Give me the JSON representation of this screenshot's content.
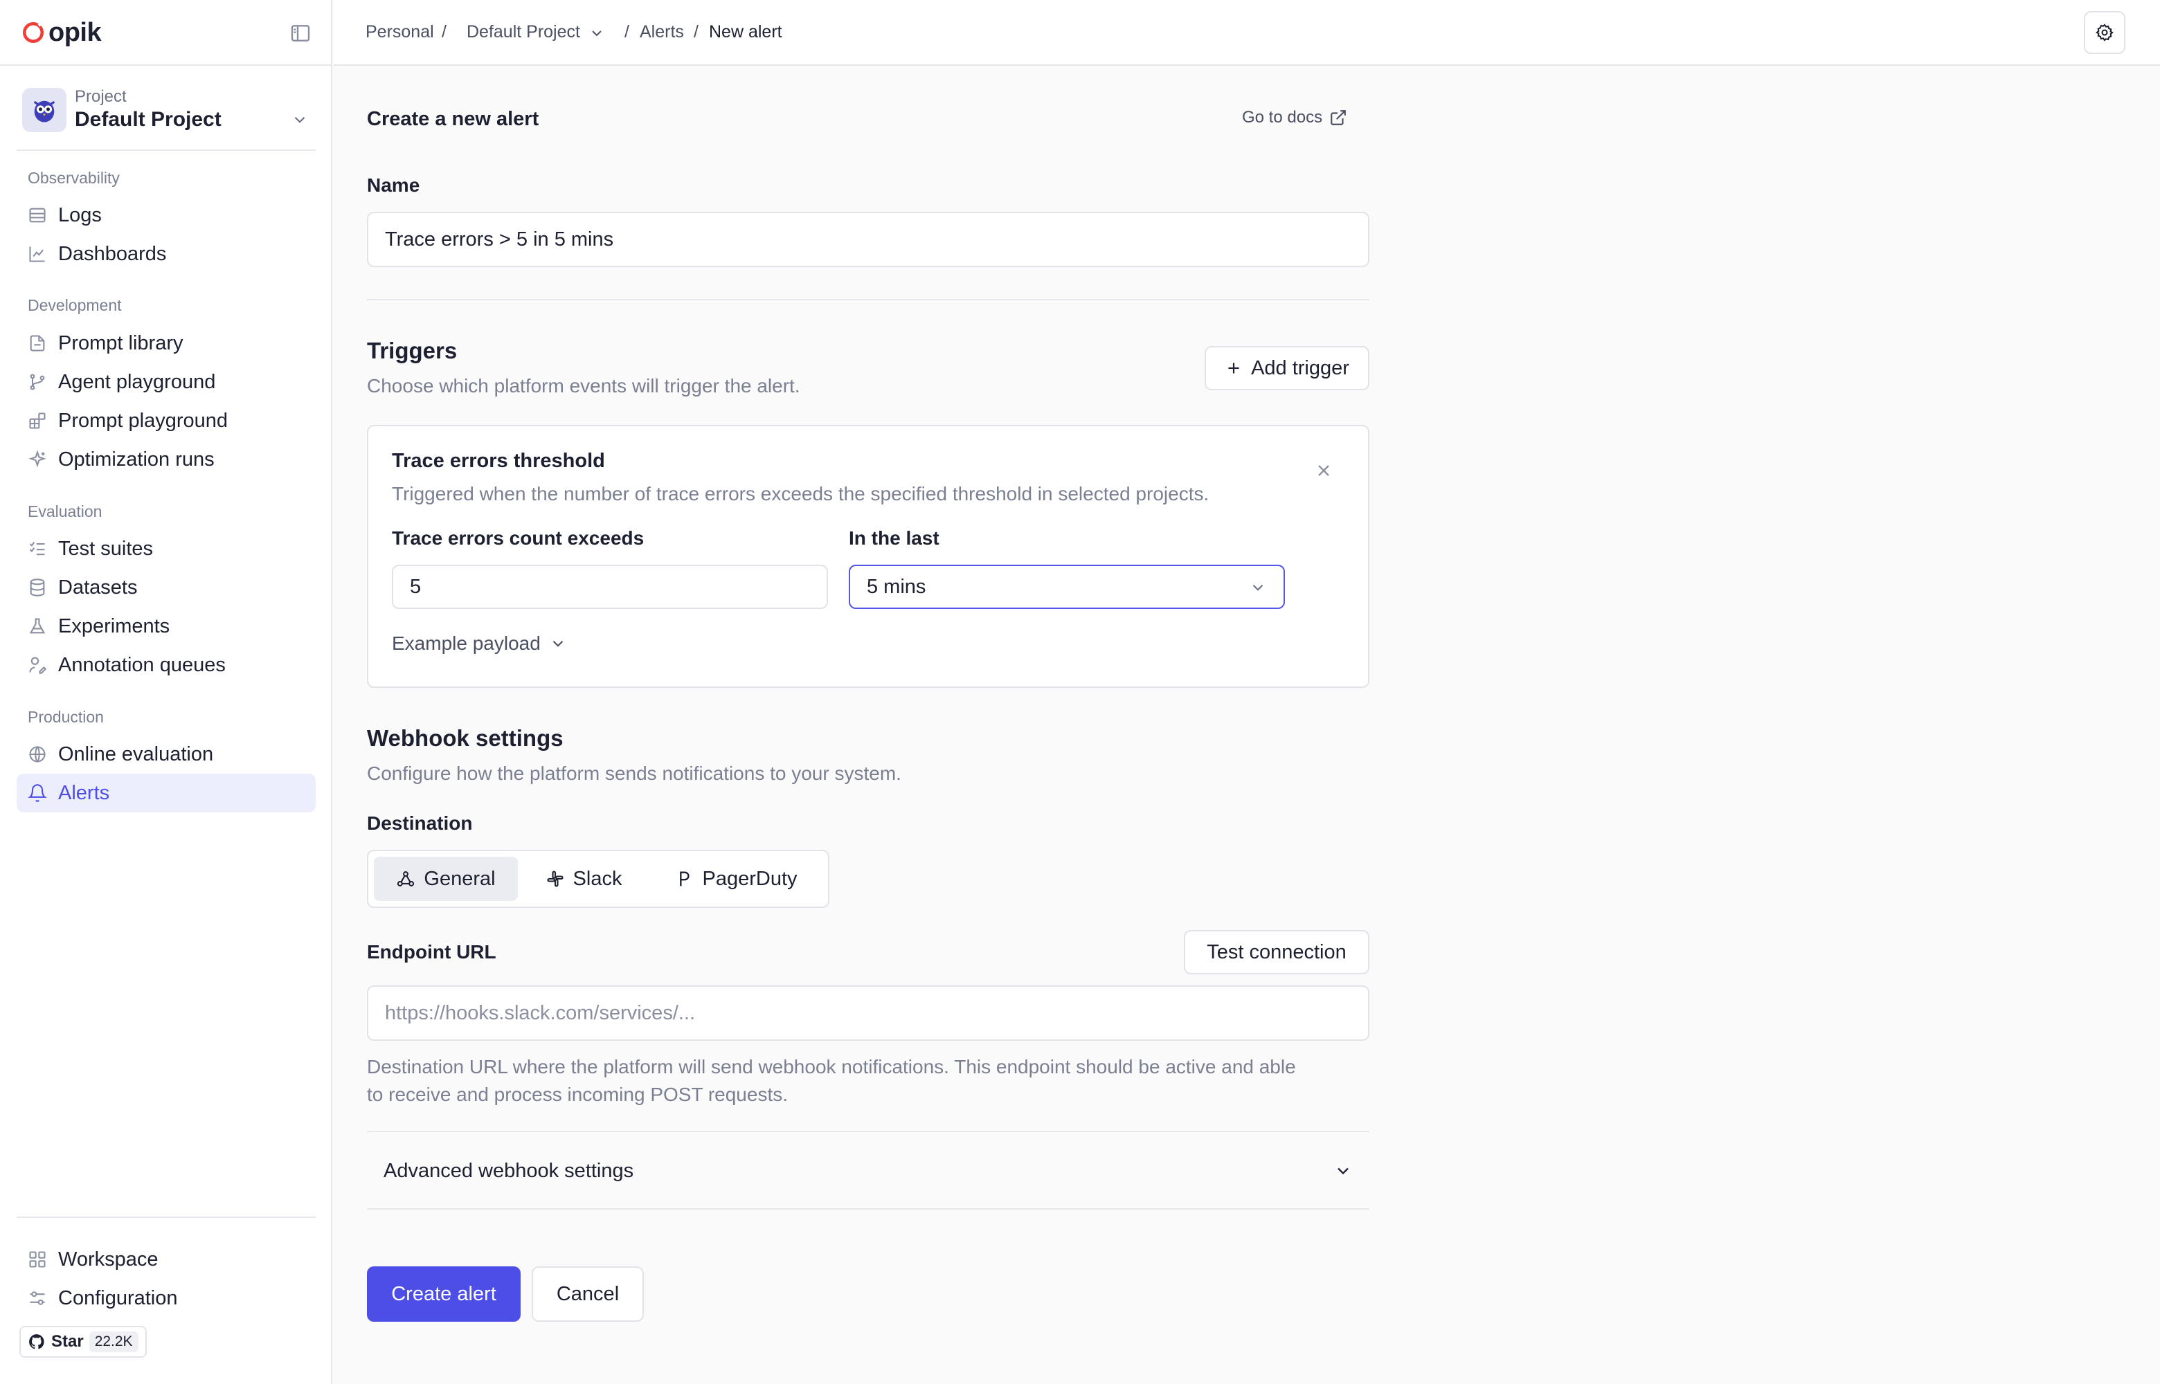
{
  "app": {
    "logo_text": "opik"
  },
  "sidebar": {
    "project_caption": "Project",
    "project_name": "Default Project",
    "sections": {
      "observability": "Observability",
      "development": "Development",
      "evaluation": "Evaluation",
      "production": "Production"
    },
    "items": {
      "logs": "Logs",
      "dashboards": "Dashboards",
      "prompt_library": "Prompt library",
      "agent_playground": "Agent playground",
      "prompt_playground": "Prompt playground",
      "optimization_runs": "Optimization runs",
      "test_suites": "Test suites",
      "datasets": "Datasets",
      "experiments": "Experiments",
      "annotation_queues": "Annotation queues",
      "online_evaluation": "Online evaluation",
      "alerts": "Alerts",
      "workspace": "Workspace",
      "configuration": "Configuration"
    },
    "active_item": "alerts",
    "github": {
      "label": "Star",
      "count": "22.2K"
    }
  },
  "breadcrumb": {
    "personal": "Personal",
    "project": "Default Project",
    "alerts": "Alerts",
    "current": "New alert",
    "separator": "/"
  },
  "form": {
    "title": "Create a new alert",
    "docs_link": "Go to docs",
    "name_label": "Name",
    "name_value": "Trace errors > 5 in 5 mins",
    "triggers": {
      "title": "Triggers",
      "description": "Choose which platform events will trigger the alert.",
      "add_button": "Add trigger",
      "card": {
        "title": "Trace errors threshold",
        "description": "Triggered when the number of trace errors exceeds the specified threshold in selected projects.",
        "count_label": "Trace errors count exceeds",
        "count_value": "5",
        "window_label": "In the last",
        "window_value": "5 mins",
        "example_payload": "Example payload"
      }
    },
    "webhook": {
      "title": "Webhook settings",
      "description": "Configure how the platform sends notifications to your system.",
      "destination_label": "Destination",
      "destinations": {
        "general": "General",
        "slack": "Slack",
        "pagerduty": "PagerDuty"
      },
      "selected_destination": "general",
      "endpoint_label": "Endpoint URL",
      "test_button": "Test connection",
      "endpoint_placeholder": "https://hooks.slack.com/services/...",
      "endpoint_value": "",
      "endpoint_help_line1": "Destination URL where the platform will send webhook notifications. This endpoint should be active and able",
      "endpoint_help_line2": "to receive and process incoming POST requests.",
      "advanced": "Advanced webhook settings"
    },
    "create_button": "Create alert",
    "cancel_button": "Cancel"
  },
  "colors": {
    "accent": "#4c4ee6",
    "active_nav_bg": "#eceefe",
    "logo_ring": "#ef3e36",
    "muted_text": "#7a7f92",
    "border": "#e1e3e8"
  },
  "icons": {
    "logo": "opik-ring-logo",
    "collapse": "sidebar-panel-icon",
    "logs": "table-icon",
    "dashboards": "line-chart-icon",
    "prompt_library": "file-text-icon",
    "agent_playground": "git-branch-icon",
    "prompt_playground": "blocks-icon",
    "optimization_runs": "sparkles-icon",
    "test_suites": "list-checks-icon",
    "datasets": "database-icon",
    "experiments": "flask-icon",
    "annotation_queues": "user-pen-icon",
    "online_evaluation": "globe-icon",
    "alerts": "bell-icon",
    "workspace": "grid-icon",
    "configuration": "sliders-icon",
    "github": "github-icon",
    "settings": "gear-icon",
    "external": "external-link-icon",
    "plus": "plus-icon",
    "close": "x-icon",
    "chevron": "chevron-down-icon",
    "webhook": "webhook-icon",
    "slack": "slack-icon",
    "pagerduty": "pagerduty-icon"
  }
}
